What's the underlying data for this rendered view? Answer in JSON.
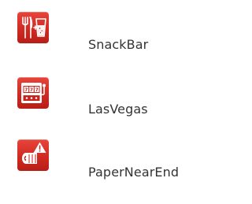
{
  "items": [
    {
      "label": "SnackBar",
      "icon": "snackbar-icon",
      "color": "#d9342b"
    },
    {
      "label": "LasVegas",
      "icon": "slot-machine-icon",
      "color": "#d9342b"
    },
    {
      "label": "PaperNearEnd",
      "icon": "paper-near-end-icon",
      "color": "#d9342b"
    }
  ]
}
